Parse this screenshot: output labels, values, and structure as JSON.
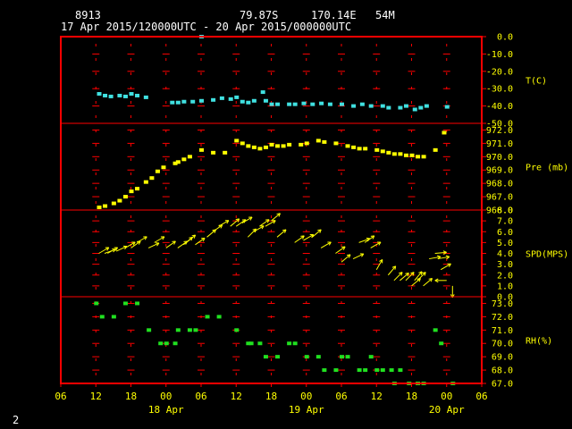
{
  "header": {
    "station_id": "8913",
    "lat": "79.87S",
    "lon": "170.14E",
    "elevation": "54M",
    "time_range": "17 Apr 2015/120000UTC - 20 Apr 2015/000000UTC"
  },
  "page_number": "2",
  "colors": {
    "background": "#000000",
    "frame": "#ff0000",
    "grid": "#ff0000",
    "labels": "#ffff00",
    "temperature": "#40e0e0",
    "pressure": "#ffff00",
    "wind": "#ffff00",
    "humidity": "#20e020"
  },
  "chart_data": {
    "type": "scatter",
    "x_unit": "hours since 17 Apr 2015 00 UTC",
    "x_range": [
      6,
      78
    ],
    "x_ticks": [
      {
        "x": 6,
        "label": "06"
      },
      {
        "x": 12,
        "label": "12"
      },
      {
        "x": 18,
        "label": "18"
      },
      {
        "x": 24,
        "label": "00"
      },
      {
        "x": 30,
        "label": "06"
      },
      {
        "x": 36,
        "label": "12"
      },
      {
        "x": 42,
        "label": "18"
      },
      {
        "x": 48,
        "label": "00"
      },
      {
        "x": 54,
        "label": "06"
      },
      {
        "x": 60,
        "label": "12"
      },
      {
        "x": 66,
        "label": "18"
      },
      {
        "x": 72,
        "label": "00"
      },
      {
        "x": 78,
        "label": "06"
      }
    ],
    "date_labels": [
      {
        "x": 24,
        "label": "18 Apr"
      },
      {
        "x": 48,
        "label": "19 Apr"
      },
      {
        "x": 72,
        "label": "20 Apr"
      }
    ],
    "panels": [
      {
        "name": "T(C)",
        "ylim": [
          -50,
          0
        ],
        "ticks": [
          "0.0",
          "-10.0",
          "-20.0",
          "-30.0",
          "-40.0",
          "-50.0"
        ],
        "tick_values": [
          0,
          -10,
          -20,
          -30,
          -40,
          -50
        ],
        "points": [
          [
            12.5,
            -33
          ],
          [
            13.5,
            -34
          ],
          [
            14.5,
            -34.5
          ],
          [
            16,
            -34
          ],
          [
            17,
            -34.5
          ],
          [
            18,
            -33
          ],
          [
            19,
            -34
          ],
          [
            20.5,
            -35
          ],
          [
            25,
            -38
          ],
          [
            26,
            -38
          ],
          [
            27,
            -37.5
          ],
          [
            28.5,
            -37.5
          ],
          [
            30,
            -37
          ],
          [
            32,
            -36.5
          ],
          [
            33.5,
            -35.5
          ],
          [
            35,
            -36
          ],
          [
            36,
            -35
          ],
          [
            37,
            -37.5
          ],
          [
            38,
            -38
          ],
          [
            39,
            -37
          ],
          [
            40.5,
            -32
          ],
          [
            41,
            -37
          ],
          [
            42,
            -39
          ],
          [
            43,
            -39
          ],
          [
            45,
            -39
          ],
          [
            46,
            -39
          ],
          [
            47.5,
            -38.5
          ],
          [
            49,
            -39
          ],
          [
            50.5,
            -38.5
          ],
          [
            52,
            -39
          ],
          [
            54,
            -39
          ],
          [
            56,
            -40
          ],
          [
            57.5,
            -39
          ],
          [
            59,
            -40
          ],
          [
            61,
            -40
          ],
          [
            62,
            -41
          ],
          [
            64,
            -41
          ],
          [
            65,
            -40
          ],
          [
            66.5,
            -42
          ],
          [
            67.5,
            -41
          ],
          [
            68.5,
            -40
          ],
          [
            72,
            -40.5
          ],
          [
            30,
            0
          ]
        ]
      },
      {
        "name": "Pre (mb)",
        "ylim": [
          966,
          972.5
        ],
        "ticks": [
          "972.0",
          "971.0",
          "970.0",
          "969.0",
          "968.0",
          "967.0",
          "966.0"
        ],
        "tick_values": [
          972,
          971,
          970,
          969,
          968,
          967,
          966
        ],
        "points": [
          [
            12.5,
            966.2
          ],
          [
            13.5,
            966.3
          ],
          [
            15,
            966.5
          ],
          [
            16,
            966.7
          ],
          [
            17,
            967
          ],
          [
            18,
            967.4
          ],
          [
            19,
            967.6
          ],
          [
            20.5,
            968.1
          ],
          [
            21.5,
            968.4
          ],
          [
            22.5,
            968.9
          ],
          [
            23.5,
            969.2
          ],
          [
            25.5,
            969.5
          ],
          [
            26,
            969.6
          ],
          [
            27,
            969.8
          ],
          [
            28,
            970
          ],
          [
            30,
            970.5
          ],
          [
            32,
            970.3
          ],
          [
            34,
            970.3
          ],
          [
            36,
            971.2
          ],
          [
            37,
            971
          ],
          [
            38,
            970.8
          ],
          [
            39,
            970.7
          ],
          [
            40,
            970.6
          ],
          [
            41,
            970.7
          ],
          [
            42,
            970.9
          ],
          [
            43,
            970.8
          ],
          [
            44,
            970.8
          ],
          [
            45,
            970.9
          ],
          [
            47,
            970.9
          ],
          [
            48,
            971
          ],
          [
            50,
            971.2
          ],
          [
            51,
            971.1
          ],
          [
            53,
            971
          ],
          [
            55,
            970.8
          ],
          [
            56,
            970.7
          ],
          [
            57,
            970.6
          ],
          [
            58,
            970.6
          ],
          [
            60,
            970.5
          ],
          [
            61,
            970.4
          ],
          [
            62,
            970.3
          ],
          [
            63,
            970.2
          ],
          [
            64,
            970.2
          ],
          [
            65,
            970.1
          ],
          [
            66,
            970.1
          ],
          [
            67,
            970
          ],
          [
            68,
            970
          ],
          [
            70,
            970.5
          ],
          [
            71.5,
            971.8
          ]
        ]
      },
      {
        "name": "SPD(MPS)",
        "ylim": [
          0,
          8
        ],
        "ticks": [
          "8.0",
          "7.0",
          "6.0",
          "5.0",
          "4.0",
          "3.0",
          "2.0",
          "1.0",
          "0.0"
        ],
        "tick_values": [
          8,
          7,
          6,
          5,
          4,
          3,
          2,
          1,
          0
        ],
        "barbs": [
          [
            12.5,
            4,
            60
          ],
          [
            13.5,
            4,
            70
          ],
          [
            14,
            4,
            60
          ],
          [
            15.5,
            4.2,
            65
          ],
          [
            17,
            4.5,
            60
          ],
          [
            18,
            4.5,
            55
          ],
          [
            19,
            5,
            60
          ],
          [
            21,
            4.5,
            65
          ],
          [
            22,
            5,
            60
          ],
          [
            24,
            4.5,
            55
          ],
          [
            26,
            4.5,
            55
          ],
          [
            27,
            4.8,
            50
          ],
          [
            27.5,
            5,
            50
          ],
          [
            29,
            4.8,
            55
          ],
          [
            31,
            5.5,
            50
          ],
          [
            32,
            6,
            55
          ],
          [
            33,
            6.5,
            60
          ],
          [
            35,
            6.5,
            50
          ],
          [
            36,
            6.5,
            55
          ],
          [
            37,
            6.8,
            60
          ],
          [
            38,
            5.5,
            45
          ],
          [
            39,
            6,
            60
          ],
          [
            40,
            6.5,
            55
          ],
          [
            41,
            6.5,
            60
          ],
          [
            42,
            7,
            50
          ],
          [
            43,
            5.5,
            50
          ],
          [
            46,
            5,
            55
          ],
          [
            47.5,
            5.2,
            60
          ],
          [
            49,
            5.5,
            50
          ],
          [
            50.5,
            4.5,
            60
          ],
          [
            53,
            4,
            55
          ],
          [
            54,
            3.2,
            50
          ],
          [
            56,
            3.5,
            65
          ],
          [
            57,
            5,
            70
          ],
          [
            58,
            5,
            55
          ],
          [
            59,
            4.5,
            60
          ],
          [
            60,
            2.5,
            30
          ],
          [
            62,
            2,
            40
          ],
          [
            63,
            1.5,
            45
          ],
          [
            64,
            1.5,
            50
          ],
          [
            65,
            1.5,
            45
          ],
          [
            66,
            1,
            50
          ],
          [
            66.5,
            1.5,
            40
          ],
          [
            67,
            1.5,
            45
          ],
          [
            68,
            1,
            50
          ],
          [
            69,
            3.5,
            80
          ],
          [
            70,
            4,
            85
          ],
          [
            70.5,
            3.5,
            80
          ],
          [
            71,
            2.5,
            60
          ],
          [
            72,
            1.5,
            270
          ],
          [
            73,
            1,
            180
          ]
        ]
      },
      {
        "name": "RH(%)",
        "ylim": [
          67,
          73.5
        ],
        "ticks": [
          "73.0",
          "72.0",
          "71.0",
          "70.0",
          "69.0",
          "68.0",
          "67.0"
        ],
        "tick_values": [
          73,
          72,
          71,
          70,
          69,
          68,
          67
        ],
        "points": [
          [
            12,
            73
          ],
          [
            13,
            72
          ],
          [
            15,
            72
          ],
          [
            17,
            73
          ],
          [
            19,
            73
          ],
          [
            21,
            71
          ],
          [
            23,
            70
          ],
          [
            24,
            70
          ],
          [
            25.5,
            70
          ],
          [
            26,
            71
          ],
          [
            28,
            71
          ],
          [
            29,
            71
          ],
          [
            31,
            72
          ],
          [
            33,
            72
          ],
          [
            36,
            71
          ],
          [
            38,
            70
          ],
          [
            38.5,
            70
          ],
          [
            40,
            70
          ],
          [
            41,
            69
          ],
          [
            43,
            69
          ],
          [
            45,
            70
          ],
          [
            46,
            70
          ],
          [
            48,
            69
          ],
          [
            50,
            69
          ],
          [
            51,
            68
          ],
          [
            53,
            68
          ],
          [
            54,
            69
          ],
          [
            55,
            69
          ],
          [
            57,
            68
          ],
          [
            58,
            68
          ],
          [
            59,
            69
          ],
          [
            60,
            68
          ],
          [
            61,
            68
          ],
          [
            62.5,
            68
          ],
          [
            63,
            67
          ],
          [
            64,
            68
          ],
          [
            65.5,
            67
          ],
          [
            67,
            67
          ],
          [
            68,
            67
          ],
          [
            70,
            71
          ],
          [
            71,
            70
          ],
          [
            73,
            67
          ]
        ]
      }
    ]
  }
}
